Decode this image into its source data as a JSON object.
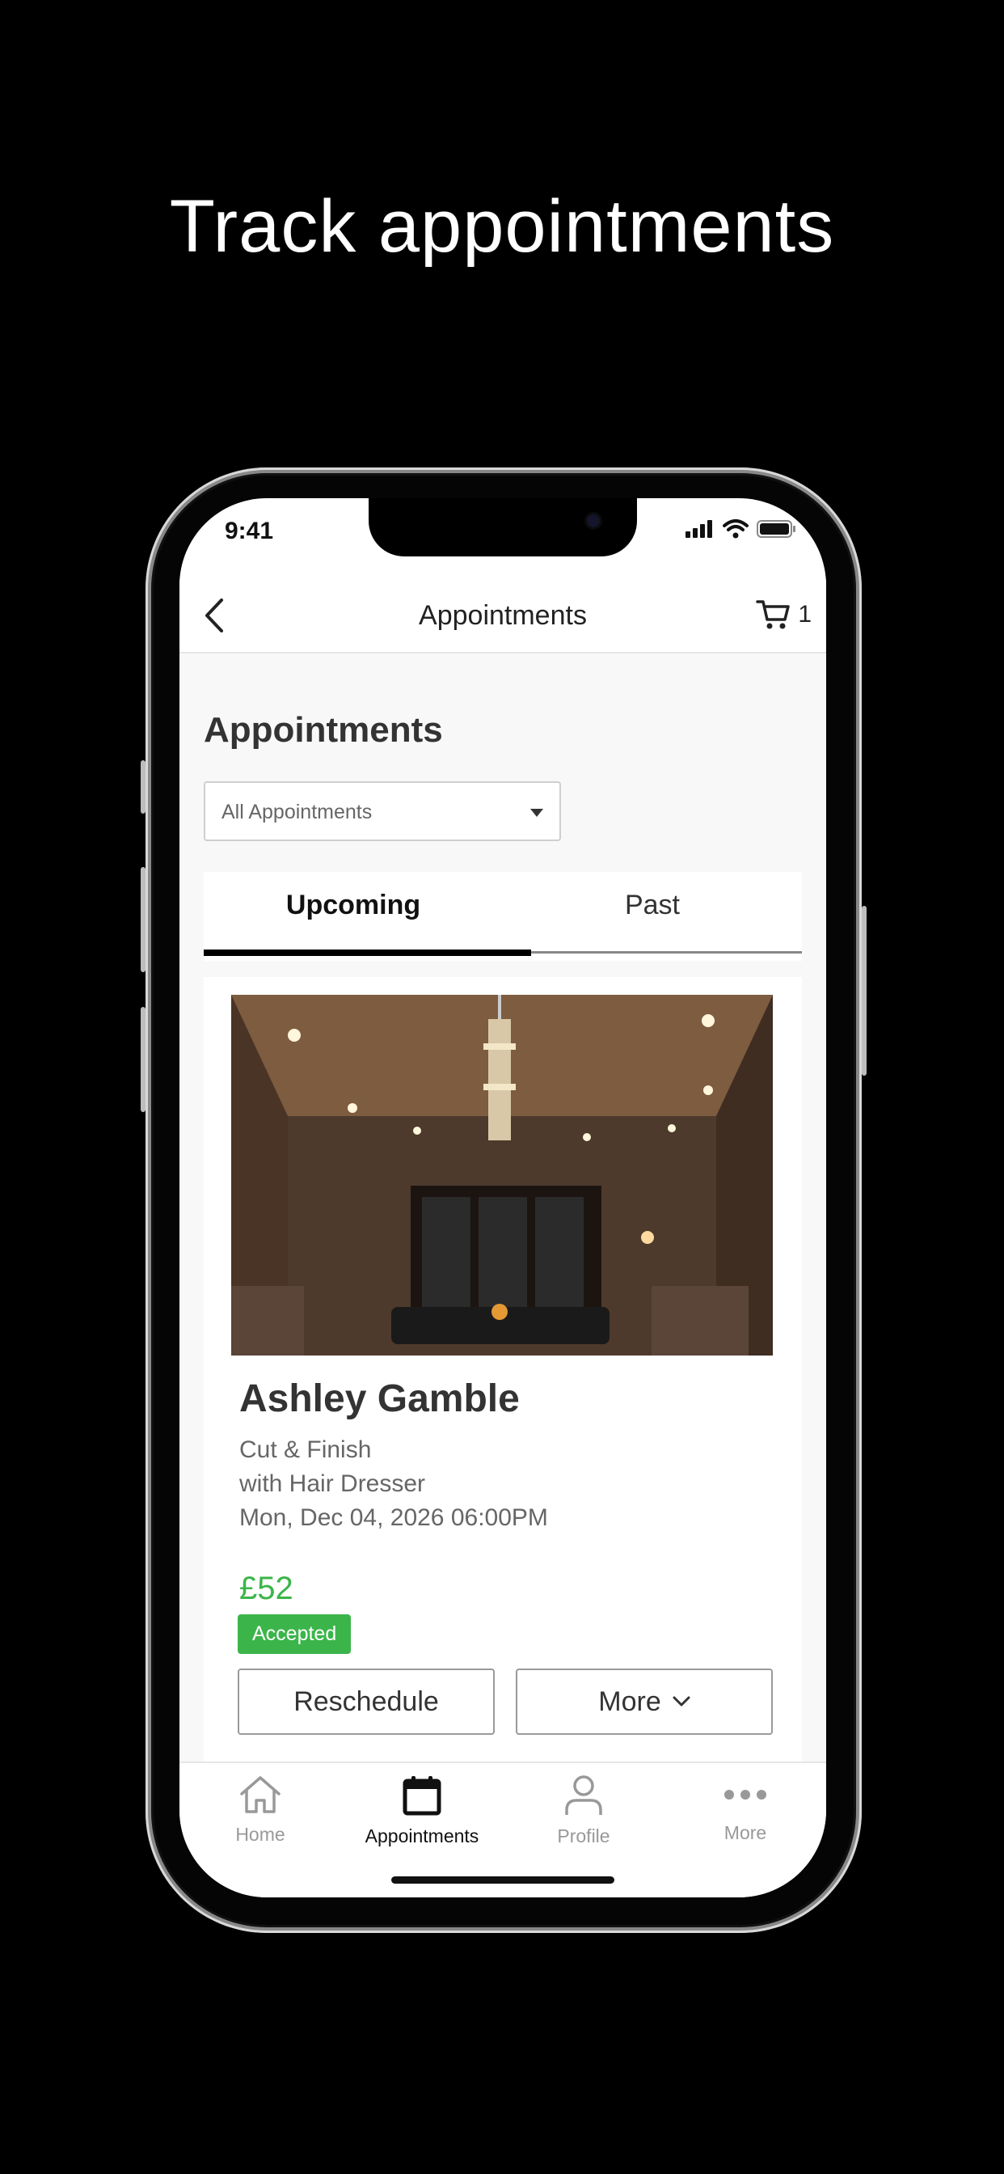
{
  "headline": "Track appointments",
  "status_bar": {
    "time": "9:41"
  },
  "nav": {
    "title": "Appointments",
    "cart_count": "1"
  },
  "page": {
    "title": "Appointments",
    "filter": {
      "selected": "All Appointments"
    }
  },
  "tabs": [
    {
      "label": "Upcoming",
      "active": true
    },
    {
      "label": "Past",
      "active": false
    }
  ],
  "appointment": {
    "name": "Ashley Gamble",
    "service": "Cut & Finish",
    "staff": "with Hair Dresser",
    "datetime": "Mon, Dec 04, 2026 06:00PM",
    "price": "£52",
    "status": "Accepted",
    "reschedule_label": "Reschedule",
    "more_label": "More"
  },
  "tabbar": [
    {
      "label": "Home",
      "icon": "home-icon",
      "active": false
    },
    {
      "label": "Appointments",
      "icon": "calendar-icon",
      "active": true
    },
    {
      "label": "Profile",
      "icon": "person-icon",
      "active": false
    },
    {
      "label": "More",
      "icon": "more-dots-icon",
      "active": false
    }
  ],
  "colors": {
    "accent_green": "#3bb54a",
    "background": "#000000"
  }
}
